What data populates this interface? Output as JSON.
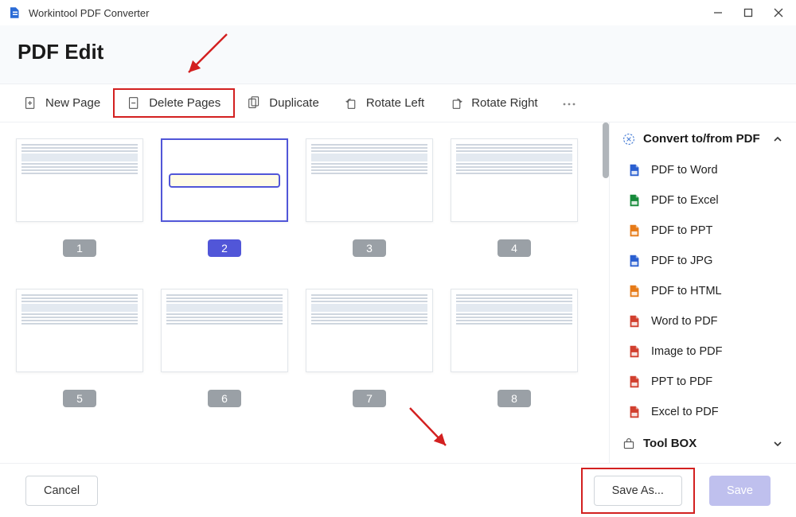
{
  "titlebar": {
    "title": "Workintool PDF Converter"
  },
  "header": {
    "title": "PDF Edit"
  },
  "toolbar": {
    "new_page": "New Page",
    "delete_pages": "Delete Pages",
    "duplicate": "Duplicate",
    "rotate_left": "Rotate Left",
    "rotate_right": "Rotate Right"
  },
  "pages": [
    {
      "num": "1"
    },
    {
      "num": "2",
      "selected": true
    },
    {
      "num": "3"
    },
    {
      "num": "4"
    },
    {
      "num": "5"
    },
    {
      "num": "6"
    },
    {
      "num": "7"
    },
    {
      "num": "8"
    }
  ],
  "sidebar": {
    "convert_header": "Convert to/from PDF",
    "toolbox_header": "Tool BOX",
    "items": [
      {
        "label": "PDF to Word",
        "color": "#2a5fd0"
      },
      {
        "label": "PDF to Excel",
        "color": "#168a3a"
      },
      {
        "label": "PDF to PPT",
        "color": "#e67a17"
      },
      {
        "label": "PDF to JPG",
        "color": "#2a5fd0"
      },
      {
        "label": "PDF to HTML",
        "color": "#e67a17"
      },
      {
        "label": "Word to PDF",
        "color": "#d13f2e"
      },
      {
        "label": "Image to PDF",
        "color": "#d13f2e"
      },
      {
        "label": "PPT to PDF",
        "color": "#d13f2e"
      },
      {
        "label": "Excel to PDF",
        "color": "#d13f2e"
      }
    ]
  },
  "footer": {
    "cancel": "Cancel",
    "save_as": "Save As...",
    "save": "Save"
  },
  "colors": {
    "highlight": "#d32020",
    "accent": "#5156d8"
  }
}
